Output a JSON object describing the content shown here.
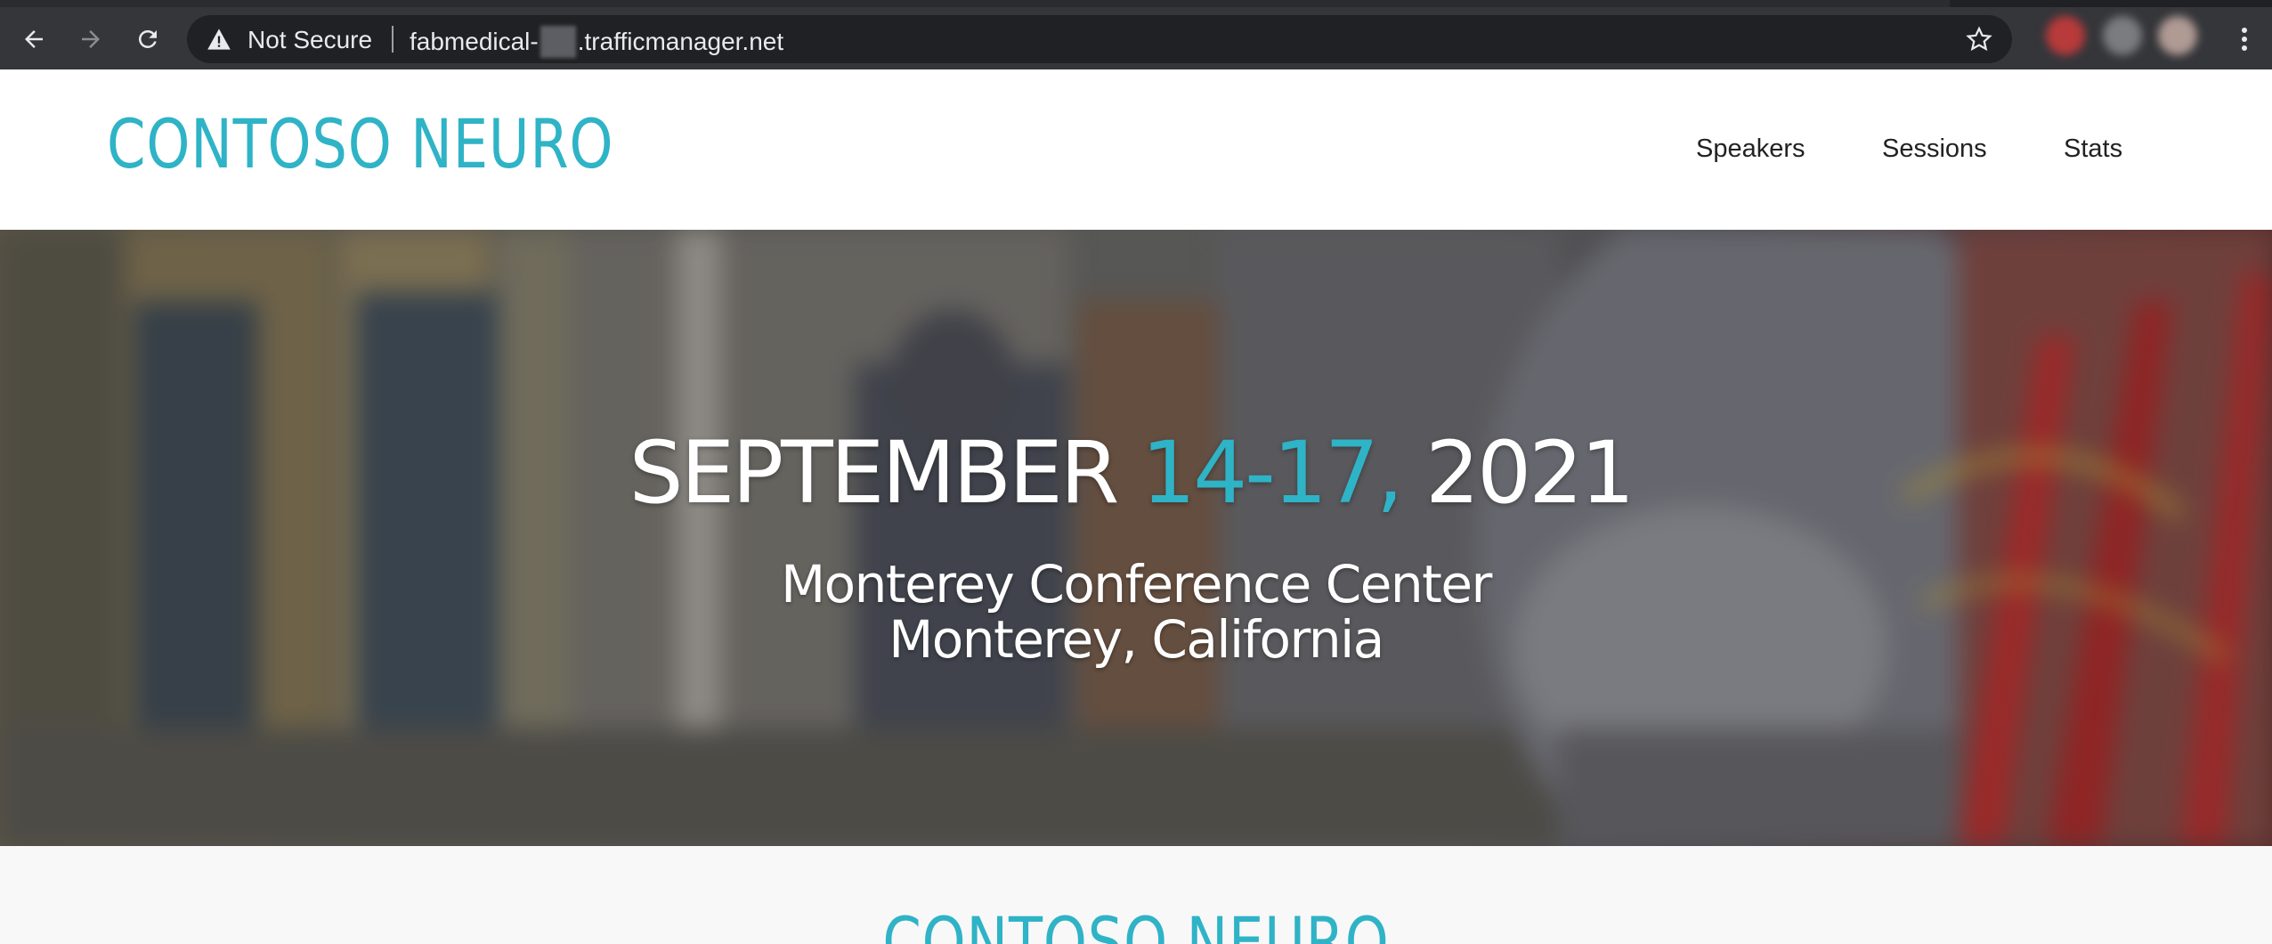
{
  "browser": {
    "security_label": "Not Secure",
    "url_prefix": "fabmedical-",
    "url_suffix": ".trafficmanager.net",
    "icons": [
      "back-arrow-icon",
      "forward-arrow-icon",
      "reload-icon",
      "warning-icon",
      "star-icon",
      "menu-dots-icon"
    ]
  },
  "header": {
    "logo": "CONTOSO NEURO",
    "nav": [
      {
        "label": "Speakers"
      },
      {
        "label": "Sessions"
      },
      {
        "label": "Stats"
      }
    ]
  },
  "hero": {
    "date_month": "SEPTEMBER ",
    "date_days": "14-17,",
    "date_year": " 2021",
    "venue": "Monterey Conference Center",
    "city": "Monterey, California"
  },
  "section": {
    "title": "CONTOSO NEURO"
  },
  "colors": {
    "accent": "#2fb3c6",
    "chrome": "#35363a",
    "omnibox": "#202124"
  }
}
